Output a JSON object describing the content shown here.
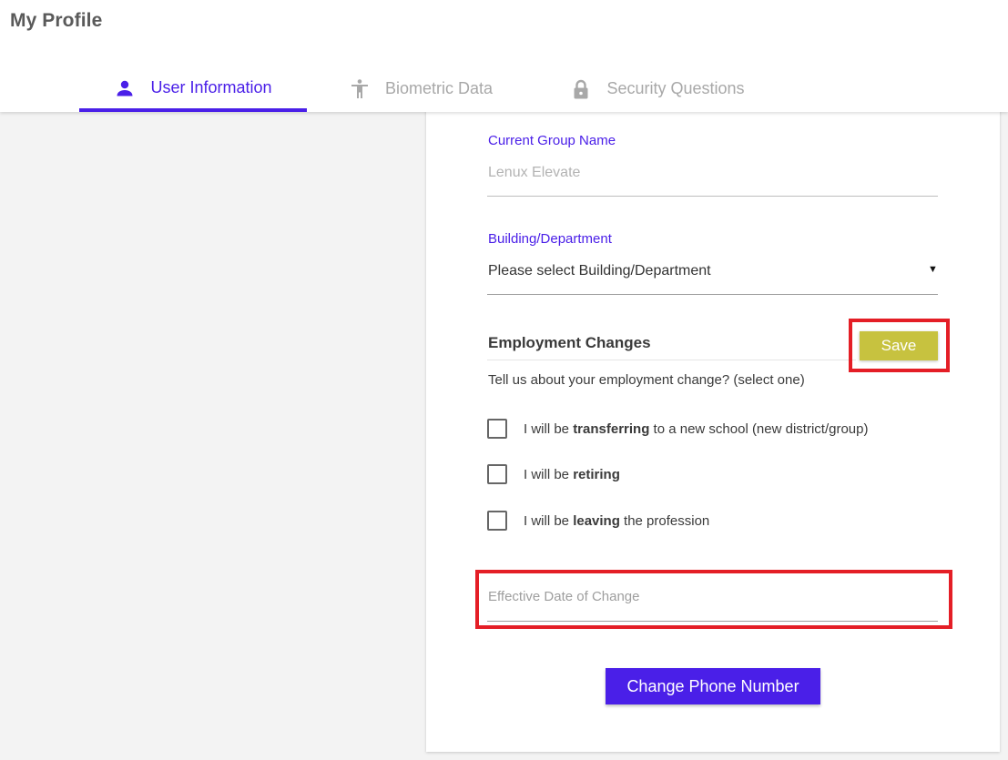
{
  "page": {
    "title": "My Profile"
  },
  "tabs": [
    {
      "label": "User Information",
      "icon": "person-icon",
      "active": true
    },
    {
      "label": "Biometric Data",
      "icon": "accessibility-icon",
      "active": false
    },
    {
      "label": "Security Questions",
      "icon": "lock-icon",
      "active": false
    }
  ],
  "form": {
    "group": {
      "label": "Current Group Name",
      "value": "Lenux Elevate"
    },
    "department": {
      "label": "Building/Department",
      "selected": "Please select Building/Department"
    },
    "employment": {
      "title": "Employment Changes",
      "save_label": "Save",
      "question": "Tell us about your employment change? (select one)",
      "options": [
        {
          "prefix": "I will be ",
          "keyword": "transferring",
          "suffix": " to a new school (new district/group)",
          "checked": false
        },
        {
          "prefix": "I will be ",
          "keyword": "retiring",
          "suffix": "",
          "checked": false
        },
        {
          "prefix": "I will be ",
          "keyword": "leaving",
          "suffix": " the profession",
          "checked": false
        }
      ]
    },
    "effective_date": {
      "placeholder": "Effective Date of Change",
      "value": ""
    },
    "phone_button_label": "Change Phone Number"
  },
  "colors": {
    "accent": "#4a1fe8",
    "save": "#c7c23f",
    "highlight": "#e41e26",
    "inactive_tab": "#a8a8a8"
  }
}
